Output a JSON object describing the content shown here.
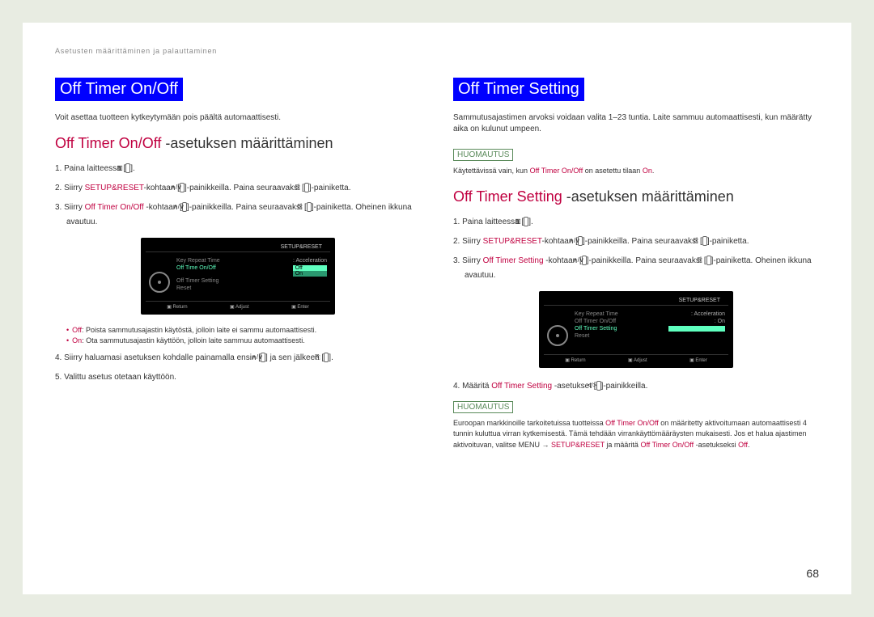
{
  "breadcrumb": "Asetusten määrittäminen ja palauttaminen",
  "left": {
    "title": "Off Timer On/Off",
    "intro": "Voit asettaa tuotteen kytkeytymään pois päältä automaattisesti.",
    "sub_accent": "Off Timer On/Off",
    "sub_rest": " -asetuksen määrittäminen",
    "step1a": "1.  Paina laitteessa [",
    "step1b": "].",
    "step2a": "2.  Siirry ",
    "step2_accent": "SETUP&RESET",
    "step2b": "-kohtaan [",
    "step2c": "]-painikkeilla. Paina seuraavaksi [",
    "step2d": "]-painiketta.",
    "step3a": "3.  Siirry ",
    "step3_accent": "Off Timer On/Off",
    "step3b": " -kohtaan [",
    "step3c": "]-painikkeilla. Paina seuraavaksi [",
    "step3d": "]-painiketta. Oheinen ikkuna avautuu.",
    "bullet1a": "Off",
    "bullet1b": ": Poista sammutusajastin käytöstä, jolloin laite ei sammu automaattisesti.",
    "bullet2a": "On",
    "bullet2b": ": Ota sammutusajastin käyttöön, jolloin laite sammuu automaattisesti.",
    "step4a": "4.  Siirry haluamasi asetuksen kohdalle painamalla ensin [",
    "step4b": "] ja sen jälkeen [",
    "step4c": "].",
    "step5": "5.  Valittu asetus otetaan käyttöön.",
    "osd": {
      "header": "SETUP&RESET",
      "r1l": "Key Repeat Time",
      "r1r": ": Acceleration",
      "r2l": "Off Time On/Off",
      "r2off": "Off",
      "r2on": "On",
      "r3l": "Off Timer Setting",
      "r4l": "Reset",
      "f1": "Return",
      "f2": "Adjust",
      "f3": "Enter"
    }
  },
  "right": {
    "title": "Off Timer Setting",
    "intro": "Sammutusajastimen arvoksi voidaan valita 1–23 tuntia. Laite sammuu automaattisesti, kun määrätty aika on kulunut umpeen.",
    "note1_label": "HUOMAUTUS",
    "note1a": "Käytettävissä vain, kun ",
    "note1_accent1": "Off Timer On/Off",
    "note1b": " on asetettu tilaan ",
    "note1_accent2": "On",
    "note1c": ".",
    "sub_accent": "Off Timer Setting",
    "sub_rest": " -asetuksen määrittäminen",
    "step1a": "1.  Paina laitteessa [",
    "step1b": "].",
    "step2a": "2.  Siirry ",
    "step2_accent": "SETUP&RESET",
    "step2b": "-kohtaan [",
    "step2c": "]-painikkeilla. Paina seuraavaksi [",
    "step2d": "]-painiketta.",
    "step3a": "3.  Siirry ",
    "step3_accent": "Off Timer Setting",
    "step3b": " -kohtaan [",
    "step3c": "]-painikkeilla. Paina seuraavaksi [",
    "step3d": "]-painiketta. Oheinen ikkuna avautuu.",
    "step4a": "4.  Määritä ",
    "step4_accent": "Off Timer Setting",
    "step4b": " -asetukset [",
    "step4c": "]-painikkeilla.",
    "note2_label": "HUOMAUTUS",
    "note2a": "Euroopan markkinoille tarkoitetuissa tuotteissa ",
    "note2_accent1": "Off Timer On/Off",
    "note2b": " on määritetty aktivoitumaan automaattisesti 4 tunnin kuluttua virran kytkemisestä. Tämä tehdään virrankäyttömääräysten mukaisesti. Jos et halua ajastimen aktivoituvan, valitse MENU → ",
    "note2_accent2": "SETUP&RESET",
    "note2c": " ja määritä ",
    "note2_accent3": "Off Timer On/Off",
    "note2d": " -asetukseksi ",
    "note2_accent4": "Off",
    "note2e": ".",
    "osd": {
      "header": "SETUP&RESET",
      "r1l": "Key Repeat Time",
      "r1r": ": Acceleration",
      "r2l": "Off Timer On/Off",
      "r2r": ": On",
      "r3l": "Off Timer Setting",
      "r4l": "Reset",
      "f1": "Return",
      "f2": "Adjust",
      "f3": "Enter"
    }
  },
  "icons": {
    "menu": "▥",
    "updown": "∧/∨",
    "enter": "⎘",
    "leftright": "</>"
  },
  "page_number": "68"
}
